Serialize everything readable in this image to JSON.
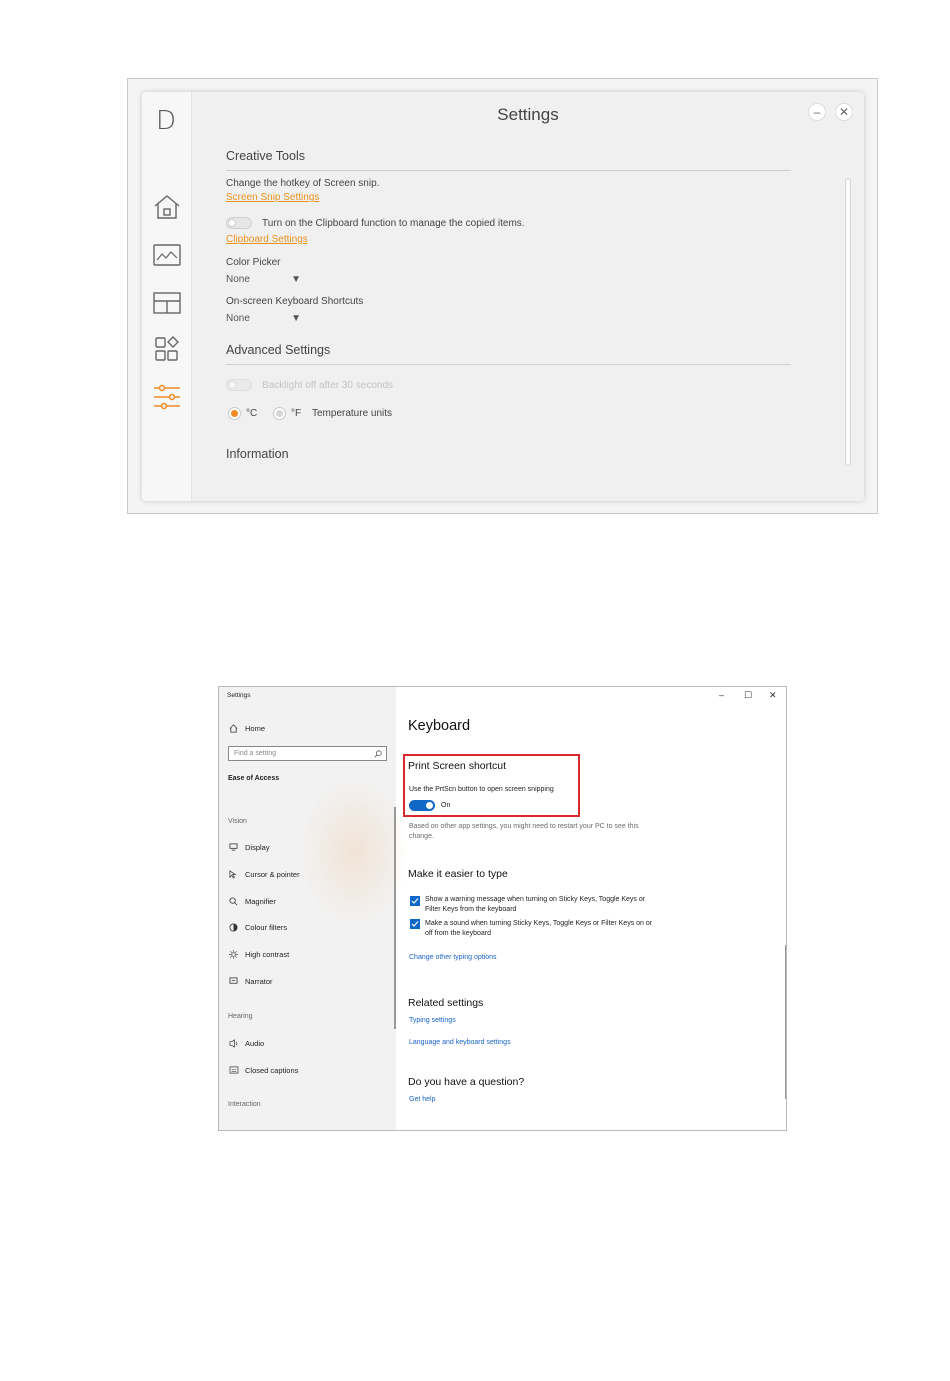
{
  "app1": {
    "logo": "D",
    "title": "Settings",
    "minimize_glyph": "–",
    "close_glyph": "✕",
    "nav": [
      "home-icon",
      "photo-icon",
      "layout-icon",
      "apps-icon",
      "sliders-icon"
    ],
    "accent_color": "#ef8c22",
    "creative_tools": {
      "heading": "Creative Tools",
      "hotkey_text": "Change the hotkey of Screen snip.",
      "screen_snip_link": "Screen Snip Settings",
      "clipboard_toggle_label": "Turn on the Clipboard function to manage the copied items.",
      "clipboard_link": "Clipboard Settings",
      "color_picker_label": "Color Picker",
      "color_picker_value": "None",
      "osk_label": "On-screen Keyboard Shortcuts",
      "osk_value": "None",
      "dropdown_arrow": "▼"
    },
    "advanced": {
      "heading": "Advanced Settings",
      "backlight_label": "Backlight off after 30 seconds",
      "celsius": "°C",
      "fahrenheit": "°F",
      "temperature_label": "Temperature units"
    },
    "information_heading": "Information"
  },
  "app2": {
    "window_title": "Settings",
    "controls": {
      "minimize": "–",
      "maximize": "☐",
      "close": "✕"
    },
    "sidebar": {
      "home": "Home",
      "search_placeholder": "Find a setting",
      "category": "Ease of Access",
      "groups": {
        "vision": "Vision",
        "hearing": "Hearing",
        "interaction": "Interaction"
      },
      "vision_items": [
        "Display",
        "Cursor & pointer",
        "Magnifier",
        "Colour filters",
        "High contrast",
        "Narrator"
      ],
      "hearing_items": [
        "Audio",
        "Closed captions"
      ]
    },
    "main": {
      "title": "Keyboard",
      "print_screen": {
        "heading": "Print Screen shortcut",
        "description": "Use the PrtScn button to open screen snipping",
        "toggle_state": "On",
        "note": "Based on other app settings, you might need to restart your PC to see this change."
      },
      "type": {
        "heading": "Make it easier to type",
        "check1": "Show a warning message when turning on Sticky Keys, Toggle Keys or Filter Keys from the keyboard",
        "check2": "Make a sound when turning Sticky Keys, Toggle Keys or Filter Keys on or off from the keyboard",
        "link": "Change other typing options"
      },
      "related": {
        "heading": "Related settings",
        "link1": "Typing settings",
        "link2": "Language and keyboard settings"
      },
      "question": {
        "heading": "Do you have a question?",
        "link": "Get help"
      }
    },
    "accent_color": "#0f67c6",
    "highlight_color": "#d9272e"
  }
}
